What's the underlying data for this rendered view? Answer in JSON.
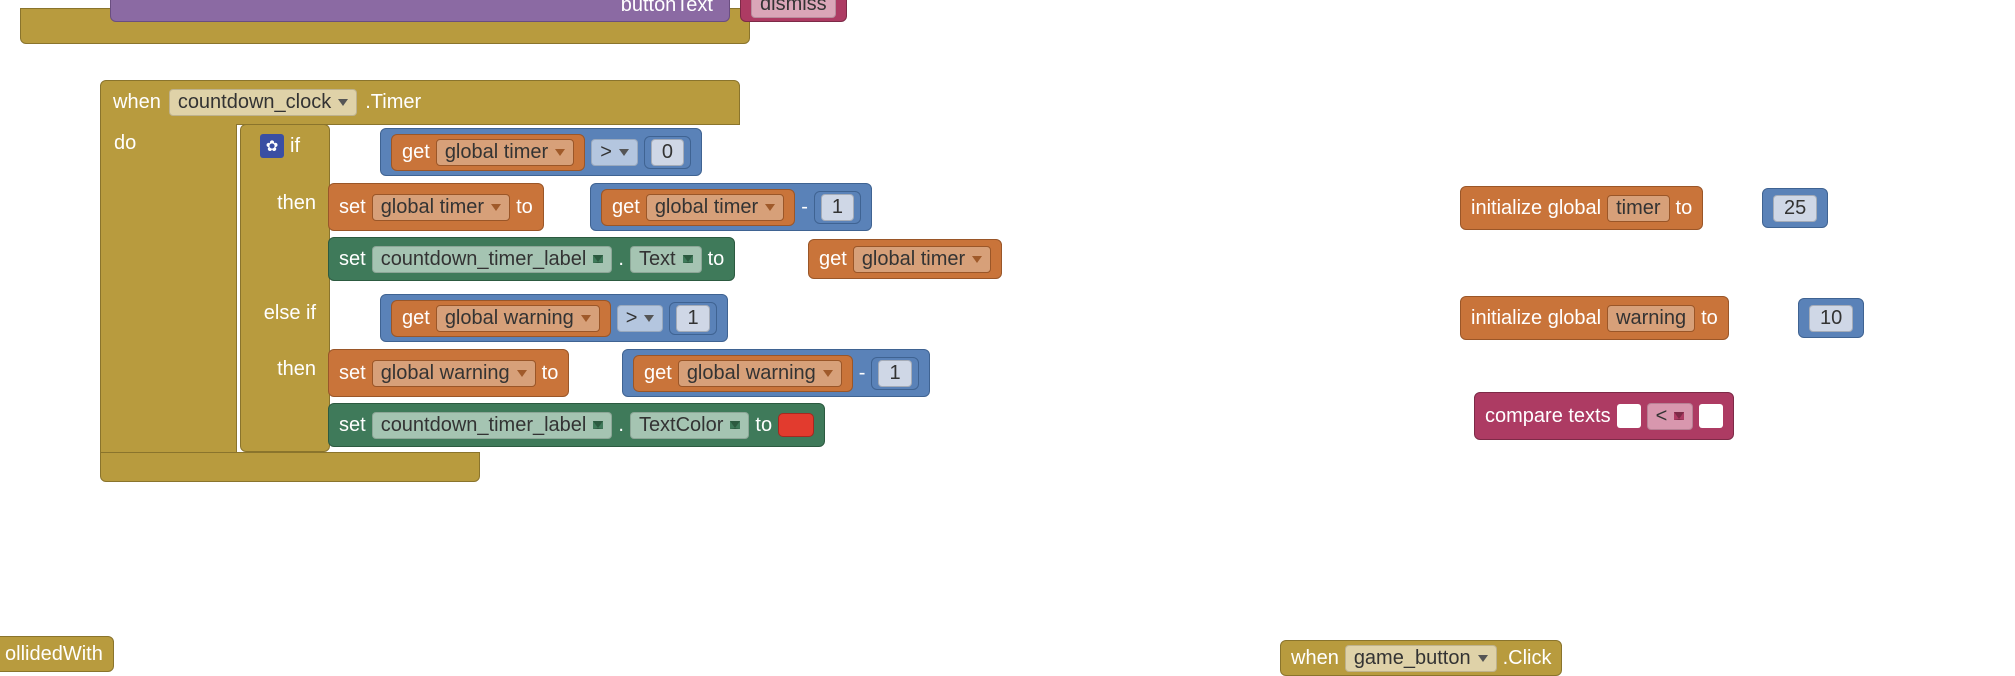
{
  "top_fragment": {
    "label": "buttonText",
    "pill": "dismiss"
  },
  "event_handler": {
    "when": "when",
    "component": "countdown_clock",
    "event": ".Timer",
    "do": "do",
    "if_block": {
      "if": "if",
      "cond1": {
        "get": "get",
        "var": "global timer",
        "op": ">",
        "val": "0"
      },
      "then1": "then",
      "stmt1a": {
        "set": "set",
        "var": "global timer",
        "to": "to",
        "rhs": {
          "get": "get",
          "rvar": "global timer",
          "minus": "-",
          "val": "1"
        }
      },
      "stmt1b": {
        "set": "set",
        "comp": "countdown_timer_label",
        "dot": ".",
        "prop": "Text",
        "to": "to",
        "rhs": {
          "get": "get",
          "rvar": "global timer"
        }
      },
      "elseif": "else if",
      "cond2": {
        "get": "get",
        "var": "global warning",
        "op": ">",
        "val": "1"
      },
      "then2": "then",
      "stmt2a": {
        "set": "set",
        "var": "global warning",
        "to": "to",
        "rhs": {
          "get": "get",
          "rvar": "global warning",
          "minus": "-",
          "val": "1"
        }
      },
      "stmt2b": {
        "set": "set",
        "comp": "countdown_timer_label",
        "dot": ".",
        "prop": "TextColor",
        "to": "to"
      }
    }
  },
  "globals": {
    "timer": {
      "init": "initialize global",
      "name": "timer",
      "to": "to",
      "val": "25"
    },
    "warning": {
      "init": "initialize global",
      "name": "warning",
      "to": "to",
      "val": "10"
    }
  },
  "compare": {
    "label": "compare texts",
    "op": "<"
  },
  "bottom_left_fragment": "ollidedWith",
  "bottom_right": {
    "when": "when",
    "comp": "game_button",
    "event": ".Click"
  }
}
